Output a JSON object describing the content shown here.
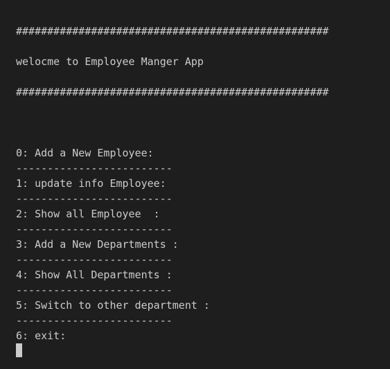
{
  "terminal": {
    "banner_top": "##################################################",
    "welcome": "welocme to Employee Manger App",
    "banner_bottom": "##################################################",
    "menu": [
      {
        "label": "0: Add a New Employee:",
        "separator": "-------------------------"
      },
      {
        "label": "1: update info Employee:",
        "separator": "-------------------------"
      },
      {
        "label": "2: Show all Employee  :",
        "separator": "-------------------------"
      },
      {
        "label": "3: Add a New Departments :",
        "separator": "-------------------------"
      },
      {
        "label": "4: Show All Departments :",
        "separator": "-------------------------"
      },
      {
        "label": "5: Switch to other department :",
        "separator": "-------------------------"
      },
      {
        "label": "6: exit:"
      }
    ],
    "colors": {
      "background": "#1e1e1e",
      "text": "#cccccc",
      "cursor": "#cccccc"
    }
  }
}
